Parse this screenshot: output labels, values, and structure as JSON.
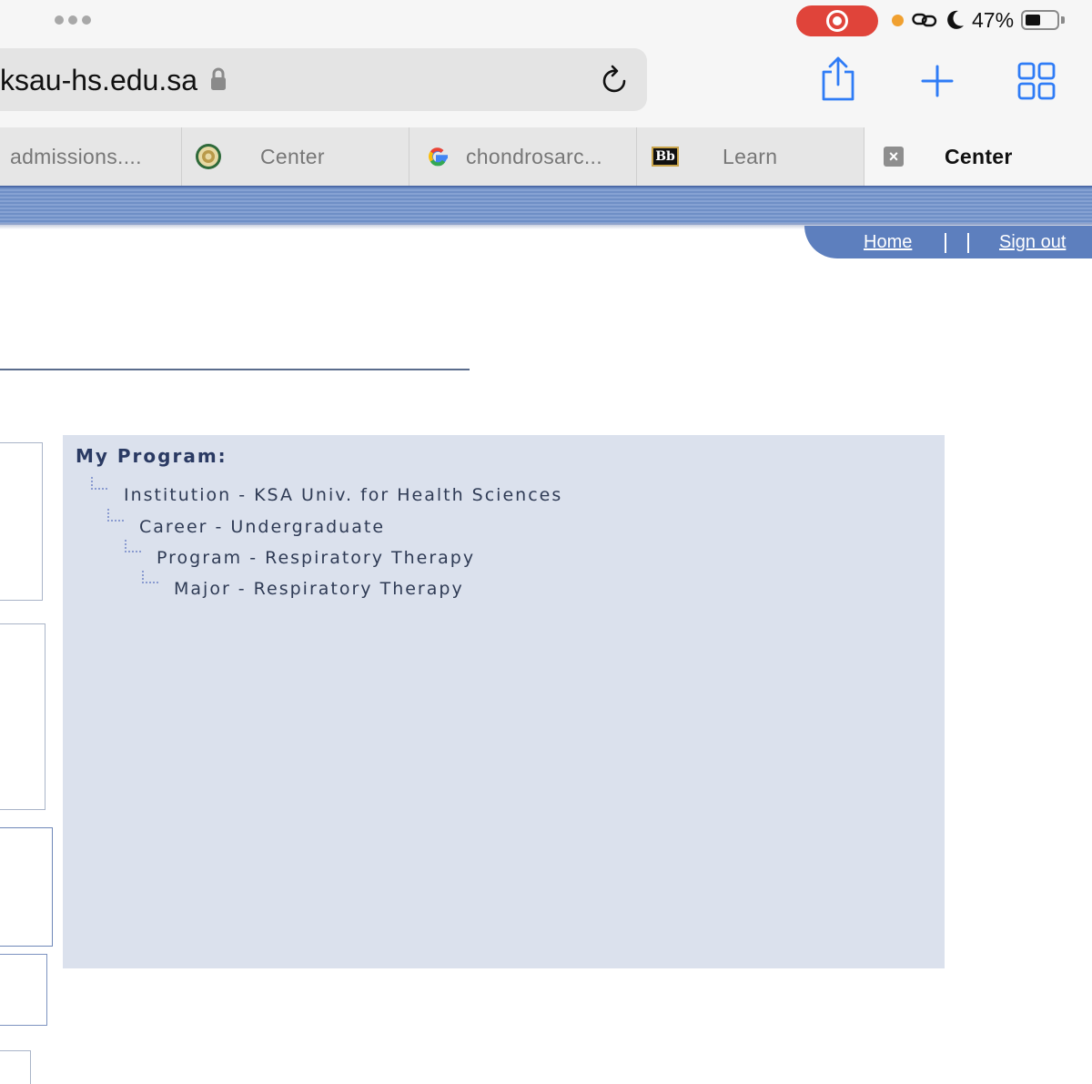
{
  "status_bar": {
    "battery_percent": "47%",
    "battery_level": 0.47,
    "recording_color": "#e0443a"
  },
  "browser": {
    "url": "ksau-hs.edu.sa",
    "accent_color": "#2f7cf6",
    "tabs": [
      {
        "label": "admissions....",
        "icon": "none",
        "active": false
      },
      {
        "label": "Center",
        "icon": "university-seal-icon",
        "active": false
      },
      {
        "label": "chondrosarc...",
        "icon": "google-icon",
        "active": false
      },
      {
        "label": "Learn",
        "icon": "blackboard-icon",
        "active": false
      },
      {
        "label": "Center",
        "icon": "close-icon",
        "active": true
      }
    ],
    "blackboard_logo_text": "Bb"
  },
  "site_nav": {
    "home": "Home",
    "sign_out": "Sign out",
    "band_color": "#6f8fc6"
  },
  "program": {
    "title": "My Program:",
    "tree": [
      "Institution - KSA Univ. for Health Sciences",
      "Career - Undergraduate",
      "Program - Respiratory Therapy",
      "Major - Respiratory Therapy"
    ],
    "panel_color": "#dbe1ed"
  }
}
